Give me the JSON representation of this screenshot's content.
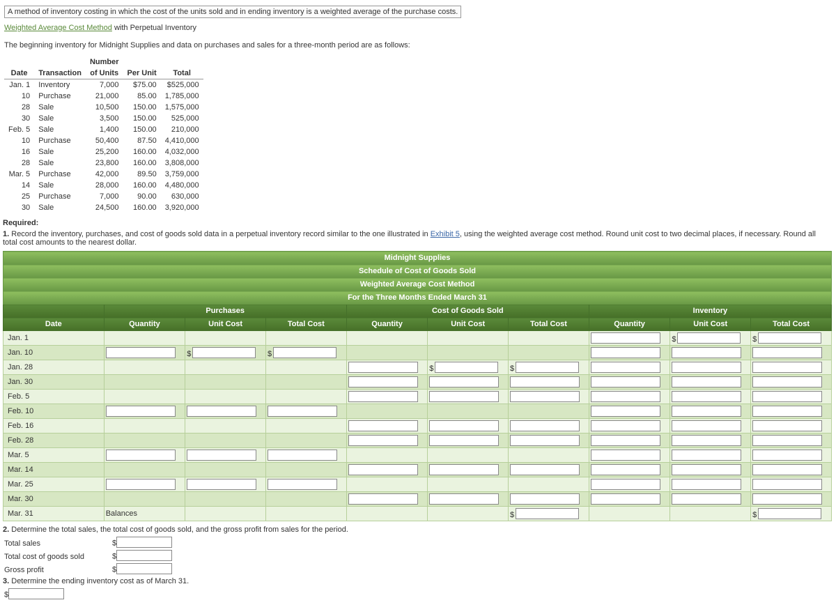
{
  "tooltip": "A method of inventory costing in which the cost of the units sold and in ending inventory is a weighted average of the purchase costs.",
  "titleLink": "Weighted Average Cost Method",
  "titleTail": " with Perpetual Inventory",
  "intro1": "The beginning inventory for Midnight Supplies and data on purchases and sales for a three-month period are as follows:",
  "dataHeaders": {
    "date": "Date",
    "trans": "Transaction",
    "num1": "Number",
    "num2": "of Units",
    "per": "Per Unit",
    "total": "Total"
  },
  "dataRows": [
    {
      "d": "Jan. 1",
      "t": "Inventory",
      "u": "7,000",
      "p": "$75.00",
      "tot": "$525,000"
    },
    {
      "d": "10",
      "t": "Purchase",
      "u": "21,000",
      "p": "85.00",
      "tot": "1,785,000"
    },
    {
      "d": "28",
      "t": "Sale",
      "u": "10,500",
      "p": "150.00",
      "tot": "1,575,000"
    },
    {
      "d": "30",
      "t": "Sale",
      "u": "3,500",
      "p": "150.00",
      "tot": "525,000"
    },
    {
      "d": "Feb. 5",
      "t": "Sale",
      "u": "1,400",
      "p": "150.00",
      "tot": "210,000"
    },
    {
      "d": "10",
      "t": "Purchase",
      "u": "50,400",
      "p": "87.50",
      "tot": "4,410,000"
    },
    {
      "d": "16",
      "t": "Sale",
      "u": "25,200",
      "p": "160.00",
      "tot": "4,032,000"
    },
    {
      "d": "28",
      "t": "Sale",
      "u": "23,800",
      "p": "160.00",
      "tot": "3,808,000"
    },
    {
      "d": "Mar. 5",
      "t": "Purchase",
      "u": "42,000",
      "p": "89.50",
      "tot": "3,759,000"
    },
    {
      "d": "14",
      "t": "Sale",
      "u": "28,000",
      "p": "160.00",
      "tot": "4,480,000"
    },
    {
      "d": "25",
      "t": "Purchase",
      "u": "7,000",
      "p": "90.00",
      "tot": "630,000"
    },
    {
      "d": "30",
      "t": "Sale",
      "u": "24,500",
      "p": "160.00",
      "tot": "3,920,000"
    }
  ],
  "required": "Required:",
  "q1a": "1.",
  "q1b": " Record the inventory, purchases, and cost of goods sold data in a perpetual inventory record similar to the one illustrated in ",
  "exhibit": "Exhibit 5",
  "q1c": ", using the weighted average cost method. Round unit cost to two decimal places, if necessary. Round all total cost amounts to the nearest dollar.",
  "sched": {
    "t1": "Midnight Supplies",
    "t2": "Schedule of Cost of Goods Sold",
    "t3": "Weighted Average Cost Method",
    "t4": "For the Three Months Ended March 31",
    "groups": {
      "purch": "Purchases",
      "cogs": "Cost of Goods Sold",
      "inv": "Inventory"
    },
    "cols": {
      "date": "Date",
      "qty": "Quantity",
      "uc": "Unit Cost",
      "tc": "Total Cost"
    },
    "dates": [
      "Jan. 1",
      "Jan. 10",
      "Jan. 28",
      "Jan. 30",
      "Feb. 5",
      "Feb. 10",
      "Feb. 16",
      "Feb. 28",
      "Mar. 5",
      "Mar. 14",
      "Mar. 25",
      "Mar. 30",
      "Mar. 31"
    ],
    "balances": "Balances",
    "dollar": "$"
  },
  "q2a": "2.",
  "q2b": "  Determine the total sales, the total cost of goods sold, and the gross profit from sales for the period.",
  "q2rows": {
    "ts": "Total sales",
    "tcogs": "Total cost of goods sold",
    "gp": "Gross profit"
  },
  "q3a": "3.",
  "q3b": "  Determine the ending inventory cost as of March 31.",
  "dollar": "$"
}
